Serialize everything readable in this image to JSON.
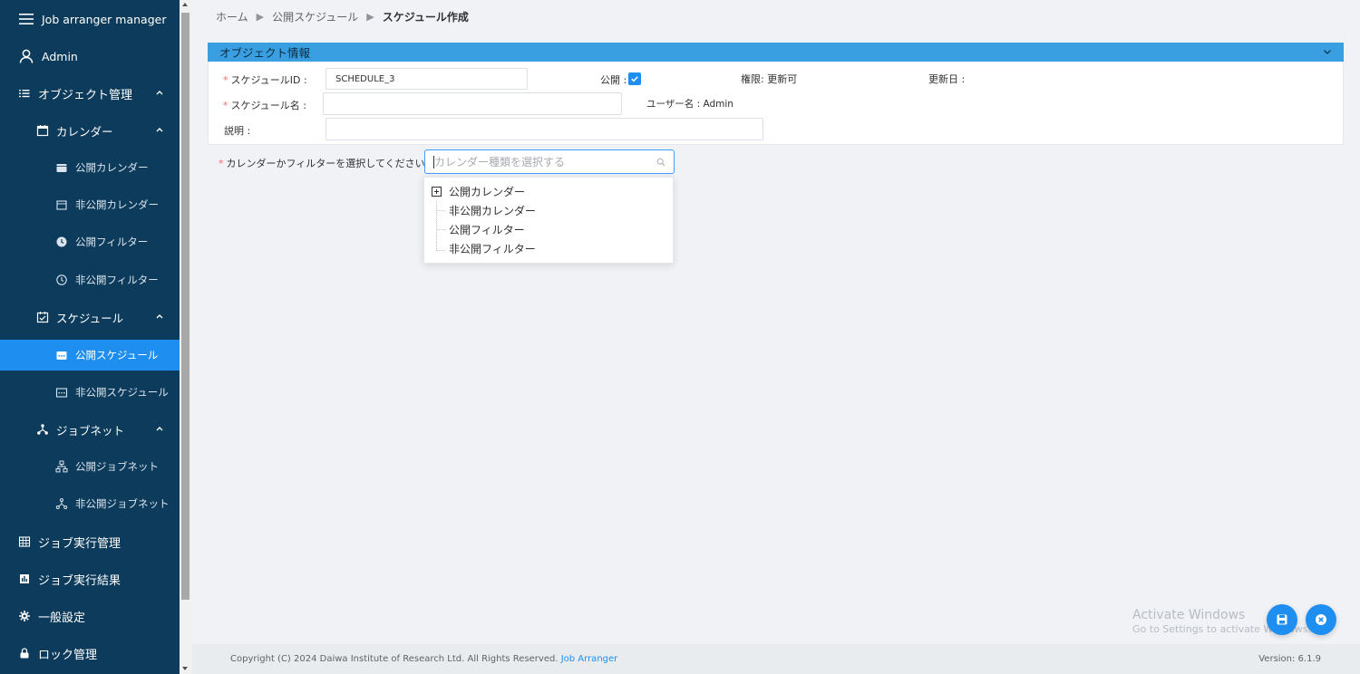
{
  "sidebar": {
    "app_title": "Job arranger manager",
    "user": "Admin",
    "items": [
      {
        "label": "オブジェクト管理"
      },
      {
        "label": "カレンダー"
      },
      {
        "label": "公開カレンダー"
      },
      {
        "label": "非公開カレンダー"
      },
      {
        "label": "公開フィルター"
      },
      {
        "label": "非公開フィルター"
      },
      {
        "label": "スケジュール"
      },
      {
        "label": "公開スケジュール"
      },
      {
        "label": "非公開スケジュール"
      },
      {
        "label": "ジョブネット"
      },
      {
        "label": "公開ジョブネット"
      },
      {
        "label": "非公開ジョブネット"
      },
      {
        "label": "ジョブ実行管理"
      },
      {
        "label": "ジョブ実行結果"
      },
      {
        "label": "一般設定"
      },
      {
        "label": "ロック管理"
      }
    ]
  },
  "breadcrumb": {
    "home": "ホーム",
    "parent": "公開スケジュール",
    "current": "スケジュール作成"
  },
  "panel": {
    "title": "オブジェクト情報",
    "schedule_id_label": "スケジュールID :",
    "schedule_id_value": "SCHEDULE_3",
    "public_label": "公開 :",
    "permission_label": "権限: 更新可",
    "updated_label": "更新日 :",
    "schedule_name_label": "スケジュール名 :",
    "schedule_name_value": "",
    "username_label": "ユーザー名 : Admin",
    "description_label": "説明 :",
    "description_value": ""
  },
  "calendar_select": {
    "label": "カレンダーかフィルターを選択してください :",
    "placeholder": "カレンダー種類を選択する",
    "options": [
      {
        "label": "公開カレンダー"
      },
      {
        "label": "非公開カレンダー"
      },
      {
        "label": "公開フィルター"
      },
      {
        "label": "非公開フィルター"
      }
    ]
  },
  "footer": {
    "copyright": "Copyright (C) 2024 Daiwa Institute of Research Ltd. All Rights Reserved.",
    "link": "Job Arranger",
    "version": "Version: 6.1.9"
  },
  "watermark": {
    "line1": "Activate Windows",
    "line2": "Go to Settings to activate Windows."
  },
  "colors": {
    "sidebar_bg": "#0d3b5c",
    "accent": "#1e8ff0",
    "panel_header": "#3a9fe0",
    "required": "#f56c6c"
  }
}
